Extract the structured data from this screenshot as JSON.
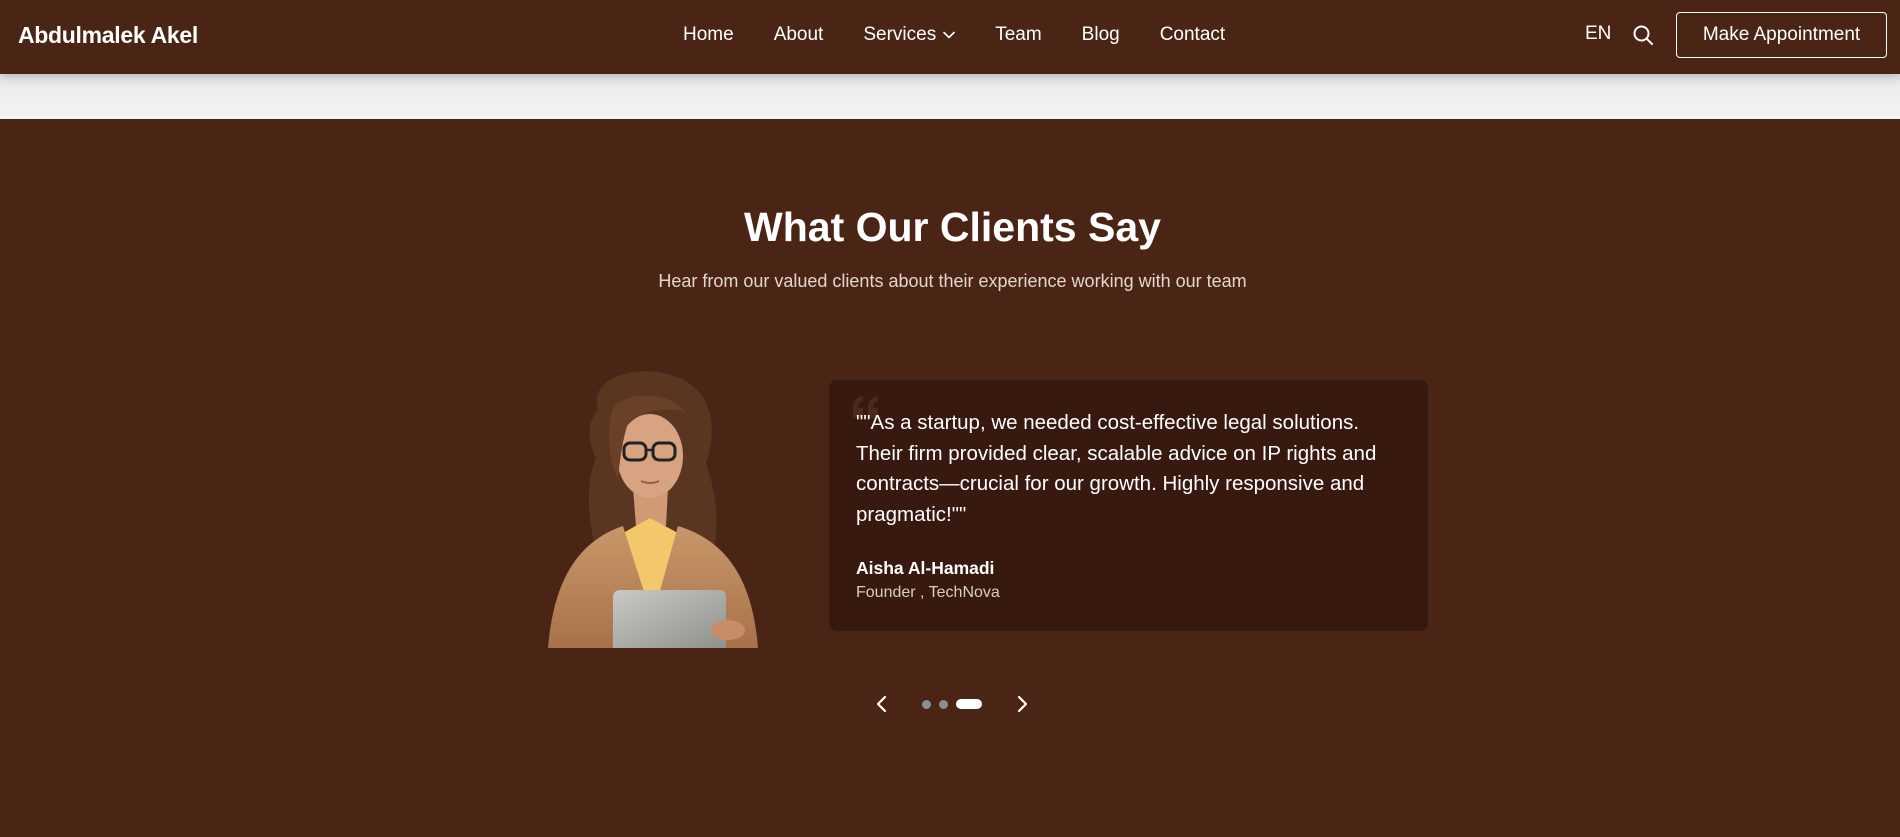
{
  "header": {
    "brand": "Abdulmalek Akel",
    "nav": [
      "Home",
      "About",
      "Services",
      "Team",
      "Blog",
      "Contact"
    ],
    "language": "EN",
    "cta_label": "Make Appointment"
  },
  "testimonials": {
    "title": "What Our Clients Say",
    "subtitle": "Hear from our valued clients about their experience working with our team",
    "quote": "\"\"As a startup, we needed cost-effective legal solutions. Their firm provided clear, scalable advice on IP rights and contracts—crucial for our growth. Highly responsive and pragmatic!\"\"",
    "client_name": "Aisha Al-Hamadi",
    "client_role": "Founder , TechNova",
    "total_slides": 3,
    "active_slide": 3
  },
  "colors": {
    "background": "#4a2516",
    "card": "#381910",
    "band": "#f2f2f2",
    "text": "#ffffff",
    "dot_inactive": "#8a8f97"
  },
  "icons": {
    "services_dropdown": "chevron-down-icon",
    "search": "search-icon",
    "prev": "chevron-left-icon",
    "next": "chevron-right-icon",
    "quote": "quote-icon"
  }
}
